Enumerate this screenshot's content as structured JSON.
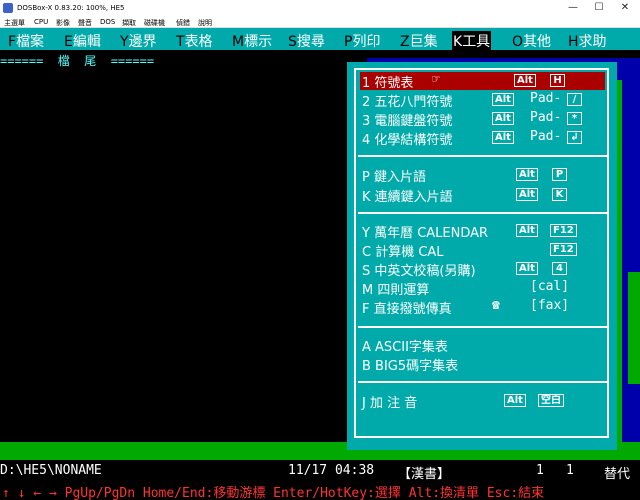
{
  "window": {
    "title": "DOSBox-X 0.83.20: 100%, HE5",
    "minimize": "—",
    "maximize": "☐",
    "close": "✕"
  },
  "host_menu": [
    "主選單",
    "CPU",
    "影像",
    "聲音",
    "DOS",
    "擷取",
    "磁碟機",
    "偵錯",
    "說明"
  ],
  "dos_menu": [
    {
      "key": "F",
      "label": "檔案"
    },
    {
      "key": "E",
      "label": "編輯"
    },
    {
      "key": "Y",
      "label": "邊界"
    },
    {
      "key": "T",
      "label": "表格"
    },
    {
      "key": "M",
      "label": "標示"
    },
    {
      "key": "S",
      "label": "搜尋"
    },
    {
      "key": "P",
      "label": "列印"
    },
    {
      "key": "Z",
      "label": "巨集"
    },
    {
      "key": "K",
      "label": "工具",
      "active": true
    },
    {
      "key": "O",
      "label": "其他"
    },
    {
      "key": "H",
      "label": "求助"
    }
  ],
  "header_line": "======  檔  尾  ======",
  "tools_menu": {
    "items": [
      {
        "text": "1 符號表",
        "glyph": "☞",
        "alt": "Alt",
        "key": "H",
        "selected": true
      },
      {
        "text": "2 五花八門符號",
        "alt": "Alt",
        "suffix": "Pad-",
        "key": "/"
      },
      {
        "text": "3 電腦鍵盤符號",
        "alt": "Alt",
        "suffix": "Pad-",
        "key": "*"
      },
      {
        "text": "4 化學結構符號",
        "alt": "Alt",
        "suffix": "Pad-",
        "key": "↲"
      },
      {
        "text": "P 鍵入片語",
        "alt": "Alt",
        "key": "P"
      },
      {
        "text": "K 連續鍵入片語",
        "alt": "Alt",
        "key": "K"
      },
      {
        "text": "Y 萬年曆 CALENDAR",
        "alt": "Alt",
        "key": "F12"
      },
      {
        "text": "C 計算機 CAL",
        "key": "F12"
      },
      {
        "text": "S 中英文校稿(另購)",
        "alt": "Alt",
        "key": "4"
      },
      {
        "text": "M 四則運算",
        "suffix": "[cal]"
      },
      {
        "text": "F 直接撥號傳真",
        "glyph": "☎",
        "suffix": "[fax]"
      },
      {
        "text": "A ASCII字集表"
      },
      {
        "text": "B BIG5碼字集表"
      },
      {
        "text": "J 加 注 音",
        "alt": "Alt",
        "key": "空白"
      }
    ]
  },
  "status_line": {
    "path": "D:\\HE5\\NONAME",
    "datetime": "11/17 04:38",
    "mode": "【漢書】",
    "line": "1",
    "col": "1",
    "replace": "替代"
  },
  "help_line": "↑ ↓ ← →  PgUp/PgDn Home/End:移動游標  Enter/HotKey:選擇  Alt:換清單  Esc:結束"
}
